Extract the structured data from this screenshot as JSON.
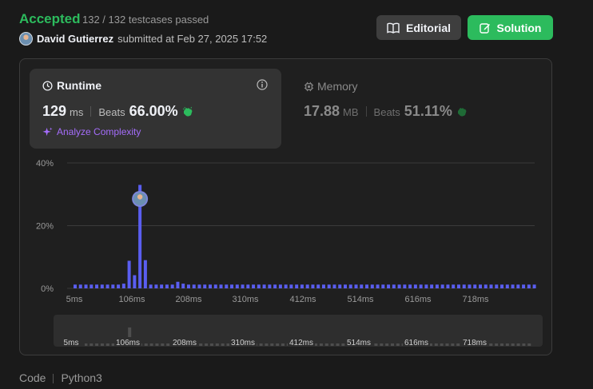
{
  "result": {
    "status": "Accepted",
    "testcases": "132 / 132 testcases passed",
    "author": "David Gutierrez",
    "submitted": "submitted at Feb 27, 2025 17:52"
  },
  "actions": {
    "editorial_label": "Editorial",
    "solution_label": "Solution"
  },
  "runtime": {
    "title": "Runtime",
    "value": "129",
    "unit": "ms",
    "beats_label": "Beats",
    "beats_pct": "66.00%",
    "analyze_label": "Analyze Complexity"
  },
  "memory": {
    "title": "Memory",
    "value": "17.88",
    "unit": "MB",
    "beats_label": "Beats",
    "beats_pct": "51.11%"
  },
  "chart_data": {
    "type": "bar",
    "y_ticks": [
      "40%",
      "20%",
      "0%"
    ],
    "ylim": [
      0,
      40
    ],
    "x_tick_labels": [
      "5ms",
      "106ms",
      "208ms",
      "310ms",
      "412ms",
      "514ms",
      "616ms",
      "718ms"
    ],
    "bin_width_ms": 7,
    "values": [
      1.2,
      1.2,
      1.2,
      1.2,
      1.2,
      1.2,
      1.2,
      1.2,
      1.2,
      1.5,
      8.8,
      4.2,
      33.0,
      9.0,
      1.2,
      1.2,
      1.2,
      1.2,
      1.2,
      2.1,
      1.5,
      1.2,
      1.2,
      1.2,
      1.2,
      1.2,
      1.2,
      1.2,
      1.2,
      1.2,
      1.2,
      1.2,
      1.2,
      1.2,
      1.2,
      1.2,
      1.2,
      1.2,
      1.2,
      1.2,
      1.2,
      1.2,
      1.2,
      1.2,
      1.2,
      1.2,
      1.2,
      1.2,
      1.2,
      1.2,
      1.2,
      1.2,
      1.2,
      1.2,
      1.2,
      1.2,
      1.2,
      1.2,
      1.2,
      1.2,
      1.2,
      1.2,
      1.2,
      1.2,
      1.2,
      1.2,
      1.2,
      1.2,
      1.2,
      1.2,
      1.2,
      1.2,
      1.2,
      1.2,
      1.2,
      1.2,
      1.2,
      1.2,
      1.2,
      1.2,
      1.2,
      1.2,
      1.2,
      1.2,
      1.2,
      1.2
    ],
    "highlight_index": 12,
    "bar_color": "#5a5ef0",
    "grid": true
  },
  "range_selector": {
    "x_tick_labels": [
      "5ms",
      "106ms",
      "208ms",
      "310ms",
      "412ms",
      "514ms",
      "616ms",
      "718ms"
    ]
  },
  "code": {
    "label": "Code",
    "language": "Python3"
  },
  "colors": {
    "accepted": "#2cbb5d",
    "analyze": "#a56dfb",
    "beats_icon": "#2cbb5d"
  }
}
